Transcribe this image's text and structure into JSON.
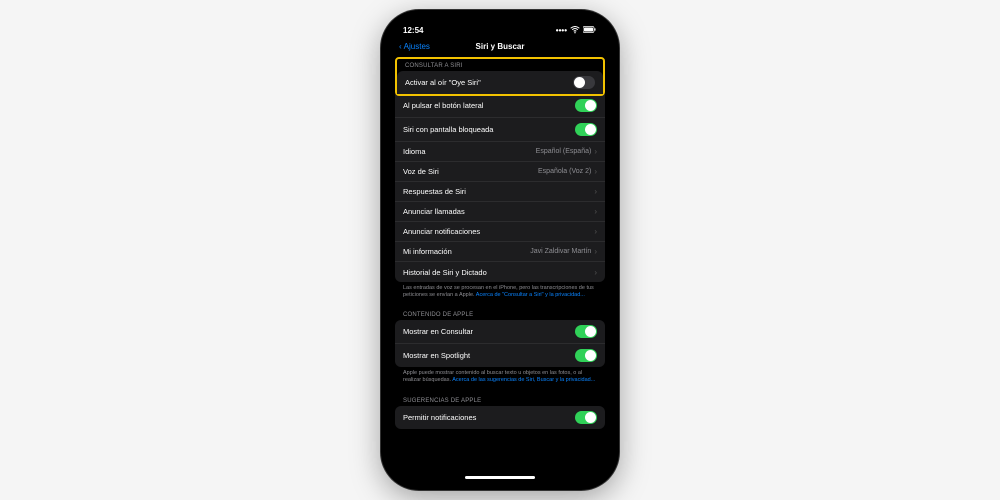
{
  "status": {
    "time": "12:54",
    "signal": "●●●",
    "wifi": "⋮",
    "battery": "▮"
  },
  "nav": {
    "back": "Ajustes",
    "title": "Siri y Buscar"
  },
  "sections": {
    "consult": {
      "header": "CONSULTAR A SIRI",
      "heySiri": "Activar al oír \"Oye Siri\"",
      "sideButton": "Al pulsar el botón lateral",
      "locked": "Siri con pantalla bloqueada",
      "language": {
        "label": "Idioma",
        "value": "Español (España)"
      },
      "voice": {
        "label": "Voz de Siri",
        "value": "Española (Voz 2)"
      },
      "responses": "Respuestas de Siri",
      "announceCalls": "Anunciar llamadas",
      "announceNotif": "Anunciar notificaciones",
      "myInfo": {
        "label": "Mi información",
        "value": "Javi Zaldivar Martín"
      },
      "history": "Historial de Siri y Dictado",
      "footer": "Las entradas de voz se procesan en el iPhone, pero las transcripciones de tus peticiones se envían a Apple.",
      "footerLink": "Acerca de \"Consultar a Siri\" y la privacidad..."
    },
    "apple": {
      "header": "CONTENIDO DE APPLE",
      "lookup": "Mostrar en Consultar",
      "spotlight": "Mostrar en Spotlight",
      "footer": "Apple puede mostrar contenido al buscar texto u objetos en las fotos, o al realizar búsquedas.",
      "footerLink": "Acerca de las sugerencias de Siri, Buscar y la privacidad..."
    },
    "suggest": {
      "header": "SUGERENCIAS DE APPLE",
      "allowNotif": "Permitir notificaciones"
    }
  }
}
